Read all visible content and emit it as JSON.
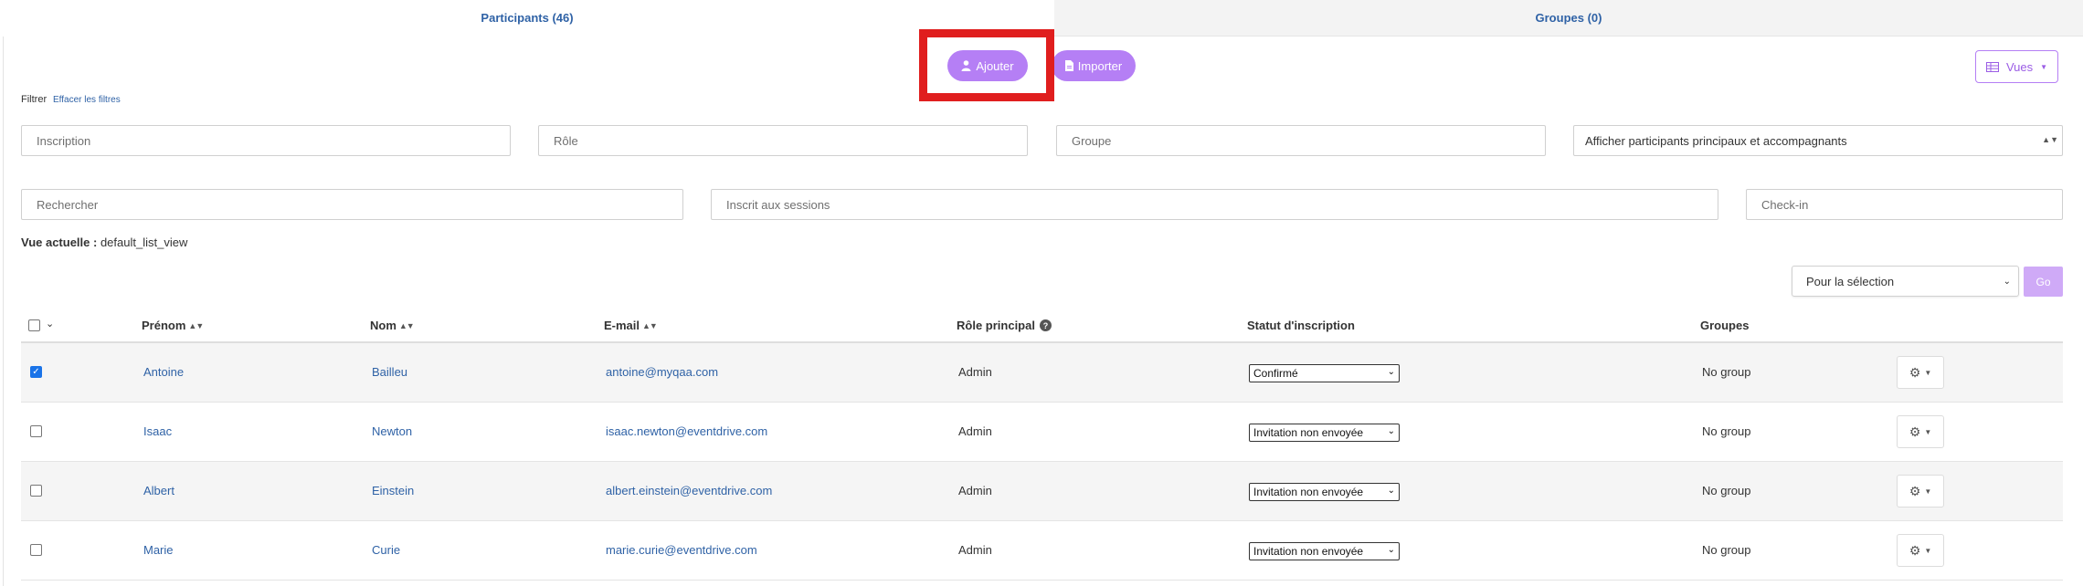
{
  "tabs": [
    {
      "label": "Participants (46)",
      "active": true
    },
    {
      "label": "Groupes (0)",
      "active": false
    }
  ],
  "actions": {
    "add_label": "Ajouter",
    "import_label": "Importer",
    "views_label": "Vues"
  },
  "filters": {
    "label": "Filtrer",
    "clear_label": "Effacer les filtres",
    "inscription_placeholder": "Inscription",
    "role_placeholder": "Rôle",
    "groupe_placeholder": "Groupe",
    "display_selected": "Afficher participants principaux et accompagnants",
    "search_placeholder": "Rechercher",
    "sessions_placeholder": "Inscrit aux sessions",
    "checkin_placeholder": "Check-in"
  },
  "current_view": {
    "label": "Vue actuelle :",
    "value": "default_list_view"
  },
  "bulk": {
    "selected": "Pour la sélection",
    "go_label": "Go"
  },
  "table": {
    "headers": {
      "first_name": "Prénom",
      "last_name": "Nom",
      "email": "E-mail",
      "main_role": "Rôle principal",
      "status": "Statut d'inscription",
      "groups": "Groupes"
    },
    "rows": [
      {
        "checked": true,
        "first_name": "Antoine",
        "last_name": "Bailleu",
        "email": "antoine@myqaa.com",
        "role": "Admin",
        "status": "Confirmé",
        "groups": "No group"
      },
      {
        "checked": false,
        "first_name": "Isaac",
        "last_name": "Newton",
        "email": "isaac.newton@eventdrive.com",
        "role": "Admin",
        "status": "Invitation non envoyée",
        "groups": "No group"
      },
      {
        "checked": false,
        "first_name": "Albert",
        "last_name": "Einstein",
        "email": "albert.einstein@eventdrive.com",
        "role": "Admin",
        "status": "Invitation non envoyée",
        "groups": "No group"
      },
      {
        "checked": false,
        "first_name": "Marie",
        "last_name": "Curie",
        "email": "marie.curie@eventdrive.com",
        "role": "Admin",
        "status": "Invitation non envoyée",
        "groups": "No group"
      }
    ]
  },
  "colors": {
    "accent": "#b57ff5",
    "link": "#2f62a6",
    "highlight": "#e01e1e"
  }
}
